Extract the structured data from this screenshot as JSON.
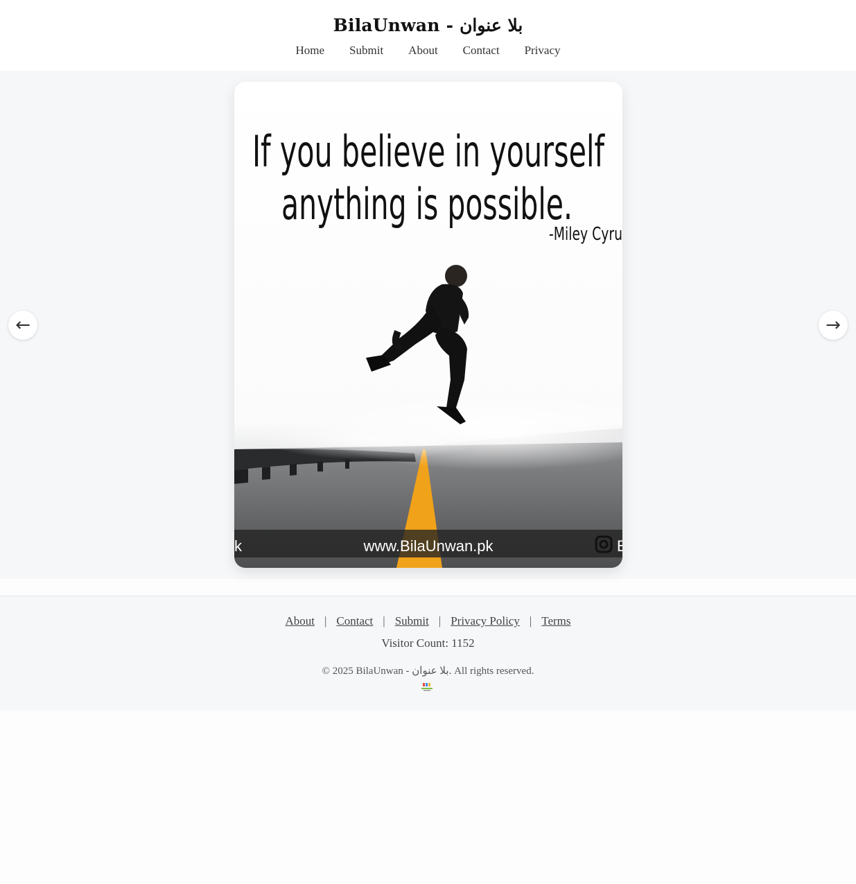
{
  "header": {
    "title": "BilaUnwan - بلا عنوان",
    "nav": [
      "Home",
      "Submit",
      "About",
      "Contact",
      "Privacy"
    ]
  },
  "slide": {
    "quote_line_1": "If you believe in yourself",
    "quote_line_2": "anything is possible.",
    "author": "-Miley Cyru",
    "watermark": "www.BilaUnwan.pk",
    "watermark_left_fragment": "k",
    "watermark_right_fragment": "B"
  },
  "controls": {
    "prev_icon": "←",
    "next_icon": "→"
  },
  "footer": {
    "links": [
      "About",
      "Contact",
      "Submit",
      "Privacy Policy",
      "Terms"
    ],
    "separator": "|",
    "visitor_count": "Visitor Count: 1152",
    "copyright": "© 2025 BilaUnwan - بلا عنوان. All rights reserved."
  },
  "colors": {
    "header_bg": "#ffffff",
    "stage_bg": "#f6f7f9",
    "footer_bg": "#f6f7f9",
    "road_line": "#f5a623"
  }
}
